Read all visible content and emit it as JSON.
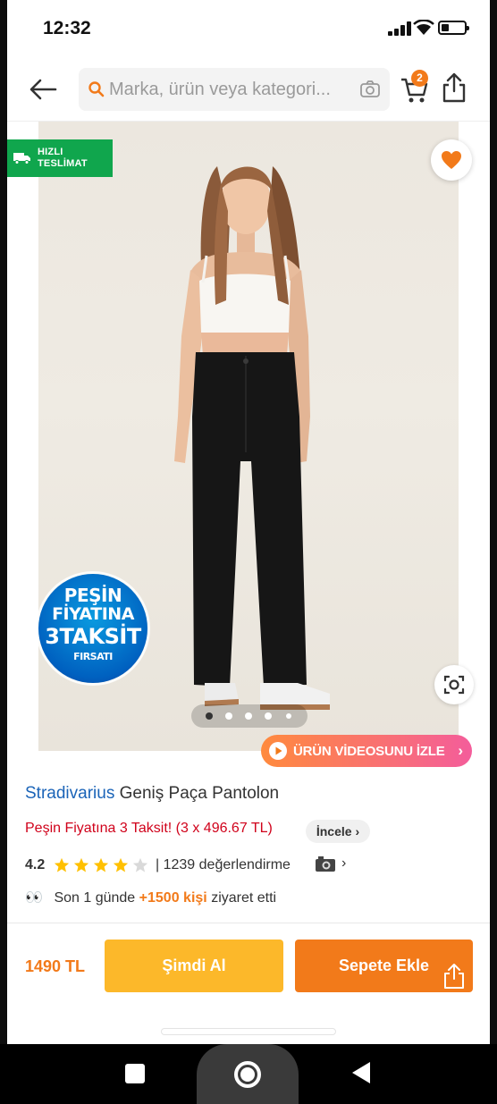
{
  "status_bar": {
    "time": "12:32"
  },
  "search": {
    "placeholder": "Marka, ürün veya kategori..."
  },
  "cart": {
    "badge_count": "2"
  },
  "image_overlay": {
    "fast_delivery_label": "HIZLI\nTESLİMAT",
    "installment_badge": {
      "line1": "PEŞİN",
      "line2": "FİYATINA",
      "line3": "3TAKSİT",
      "line4": "FIRSATI"
    },
    "pager": {
      "total": 5,
      "active_index": 0
    },
    "video_button_label": "ÜRÜN VİDEOSUNU İZLE"
  },
  "product": {
    "brand": "Stradivarius",
    "name": "Geniş Paça Pantolon",
    "installment_text": "Peşin Fiyatına 3 Taksit! (3 x 496.67 TL)",
    "review_button_label": "İncele",
    "rating": "4.2",
    "stars_filled": 4,
    "review_count_text": "| 1239 değerlendirme",
    "visitors": {
      "prefix": "Son 1 günde",
      "count": "+1500 kişi",
      "suffix": "ziyaret etti"
    }
  },
  "actions": {
    "price": "1490 TL",
    "buy_now_label": "Şimdi Al",
    "add_to_cart_label": "Sepete Ekle"
  },
  "colors": {
    "accent": "#f27a1a",
    "buy_now": "#fcb82a",
    "brand_link": "#1b64b8",
    "installment_red": "#d0021b",
    "fast_delivery_green": "#10a64d"
  }
}
